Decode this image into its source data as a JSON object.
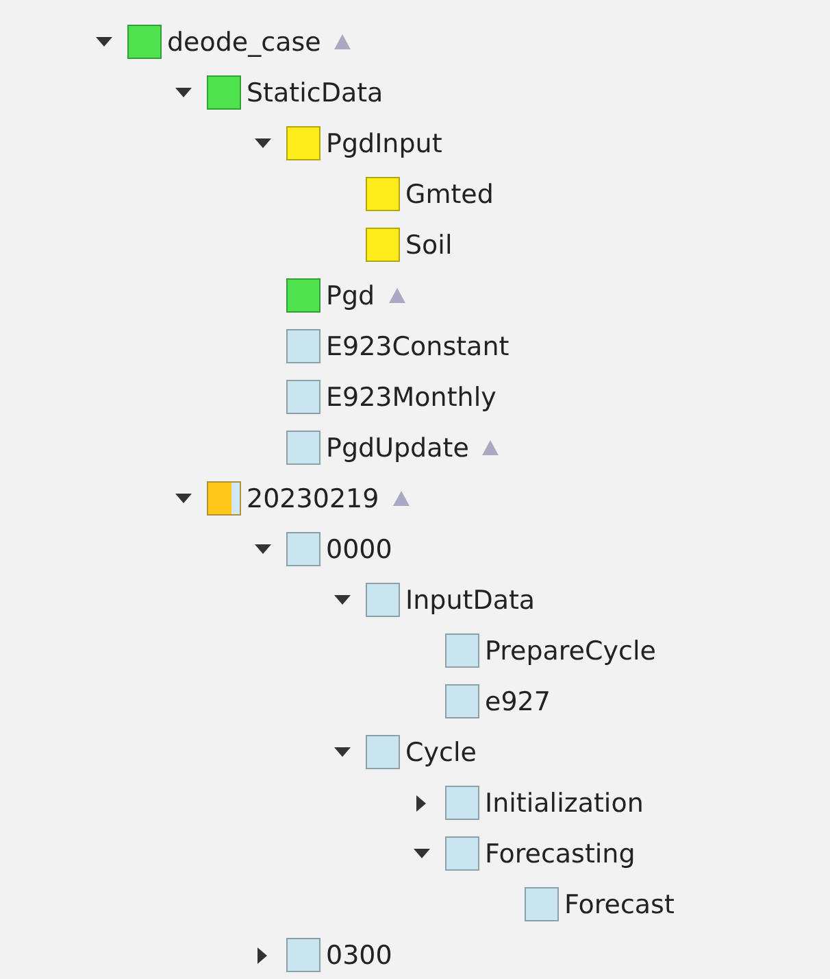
{
  "tree": [
    {
      "name": "deode_case",
      "color": "#4ee24e",
      "mixed": false,
      "expandable": true,
      "expanded": true,
      "flagged": true,
      "children": [
        {
          "name": "StaticData",
          "color": "#4ee24e",
          "mixed": false,
          "expandable": true,
          "expanded": true,
          "flagged": false,
          "children": [
            {
              "name": "PgdInput",
              "color": "#ffec1a",
              "mixed": false,
              "expandable": true,
              "expanded": true,
              "flagged": false,
              "children": [
                {
                  "name": "Gmted",
                  "color": "#ffec1a",
                  "mixed": false,
                  "expandable": false,
                  "expanded": false,
                  "flagged": false
                },
                {
                  "name": "Soil",
                  "color": "#ffec1a",
                  "mixed": false,
                  "expandable": false,
                  "expanded": false,
                  "flagged": false
                }
              ]
            },
            {
              "name": "Pgd",
              "color": "#4ee24e",
              "mixed": false,
              "expandable": false,
              "expanded": false,
              "flagged": true
            },
            {
              "name": "E923Constant",
              "color": "#c9e6f0",
              "mixed": false,
              "expandable": false,
              "expanded": false,
              "flagged": false
            },
            {
              "name": "E923Monthly",
              "color": "#c9e6f0",
              "mixed": false,
              "expandable": false,
              "expanded": false,
              "flagged": false
            },
            {
              "name": "PgdUpdate",
              "color": "#c9e6f0",
              "mixed": false,
              "expandable": false,
              "expanded": false,
              "flagged": true
            }
          ]
        },
        {
          "name": "20230219",
          "color": "#ffc61a",
          "mixed": true,
          "expandable": true,
          "expanded": true,
          "flagged": true,
          "children": [
            {
              "name": "0000",
              "color": "#c9e6f0",
              "mixed": false,
              "expandable": true,
              "expanded": true,
              "flagged": false,
              "children": [
                {
                  "name": "InputData",
                  "color": "#c9e6f0",
                  "mixed": false,
                  "expandable": true,
                  "expanded": true,
                  "flagged": false,
                  "children": [
                    {
                      "name": "PrepareCycle",
                      "color": "#c9e6f0",
                      "mixed": false,
                      "expandable": false,
                      "expanded": false,
                      "flagged": false
                    },
                    {
                      "name": "e927",
                      "color": "#c9e6f0",
                      "mixed": false,
                      "expandable": false,
                      "expanded": false,
                      "flagged": false
                    }
                  ]
                },
                {
                  "name": "Cycle",
                  "color": "#c9e6f0",
                  "mixed": false,
                  "expandable": true,
                  "expanded": true,
                  "flagged": false,
                  "children": [
                    {
                      "name": "Initialization",
                      "color": "#c9e6f0",
                      "mixed": false,
                      "expandable": true,
                      "expanded": false,
                      "flagged": false
                    },
                    {
                      "name": "Forecasting",
                      "color": "#c9e6f0",
                      "mixed": false,
                      "expandable": true,
                      "expanded": true,
                      "flagged": false,
                      "children": [
                        {
                          "name": "Forecast",
                          "color": "#c9e6f0",
                          "mixed": false,
                          "expandable": false,
                          "expanded": false,
                          "flagged": false
                        }
                      ]
                    }
                  ]
                }
              ]
            },
            {
              "name": "0300",
              "color": "#c9e6f0",
              "mixed": false,
              "expandable": true,
              "expanded": false,
              "flagged": false
            }
          ]
        }
      ]
    }
  ]
}
